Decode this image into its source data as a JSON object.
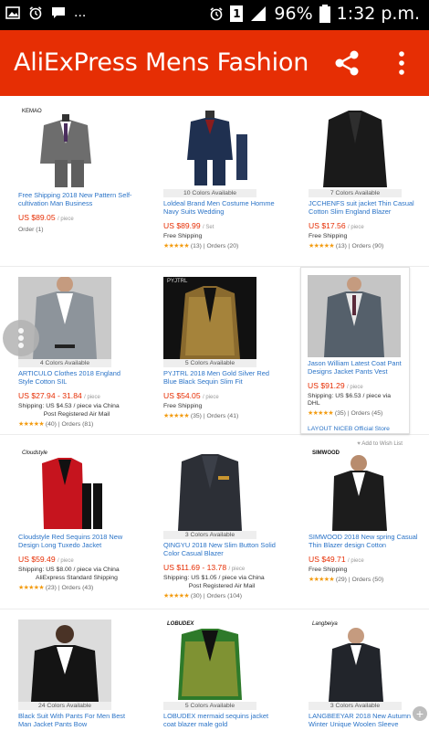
{
  "status_bar": {
    "battery_percent": "96%",
    "time": "1:32 p.m.",
    "sim_badge": "1"
  },
  "app_bar": {
    "title": "AliExPress Mens Fashion"
  },
  "products": [
    {
      "brand": "KEMAO",
      "colors": "",
      "title": "Free Shipping 2018 New Pattern Self-cultivation Man Business",
      "price": "US $89.05",
      "unit": "/ piece",
      "shipping": "",
      "shipping_detail": "",
      "stars": "",
      "rating": "",
      "orders": "Order (1)"
    },
    {
      "brand": "",
      "colors": "10 Colors Available",
      "title": "Loldeal Brand Men Costume Homme Navy Suits Wedding",
      "price": "US $89.99",
      "unit": "/ Set",
      "shipping": "Free Shipping",
      "shipping_detail": "",
      "stars": "★★★★★",
      "rating": "(13)",
      "orders": "Orders (20)"
    },
    {
      "brand": "",
      "colors": "7 Colors Available",
      "title": "JCCHENFS suit jacket Thin Casual Cotton Slim England Blazer",
      "price": "US $17.56",
      "unit": "/ piece",
      "shipping": "Free Shipping",
      "shipping_detail": "",
      "stars": "★★★★★",
      "rating": "(13)",
      "orders": "Orders (90)"
    },
    {
      "brand": "",
      "colors": "4 Colors Available",
      "title": "ARTICULO Clothes 2018 England Style Cotton SIL",
      "price": "US $27.94 - 31.84",
      "unit": "/ piece",
      "shipping": "Shipping: US $4.53 / piece via China",
      "shipping_detail": "Post Registered Air Mail",
      "stars": "★★★★★",
      "rating": "(40)",
      "orders": "Orders (81)"
    },
    {
      "brand": "PYJTRL",
      "colors": "5 Colors Available",
      "title": "PYJTRL 2018 Men Gold Silver Red Blue Black Sequin Slim Fit",
      "price": "US $54.05",
      "unit": "/ piece",
      "shipping": "Free Shipping",
      "shipping_detail": "",
      "stars": "★★★★★",
      "rating": "(35)",
      "orders": "Orders (41)"
    },
    {
      "brand": "",
      "colors": "",
      "title": "Jason William Latest Coat Pant Designs Jacket Pants Vest",
      "price": "US $91.29",
      "unit": "/ piece",
      "shipping": "Shipping: US $6.53 / piece via DHL",
      "shipping_detail": "",
      "stars": "★★★★★",
      "rating": "(35)",
      "orders": "Orders (45)",
      "store": "LAYOUT NICEB Official Store",
      "wish": "Add to Wish List"
    },
    {
      "brand": "Cloudstyle",
      "colors": "",
      "title": "Cloudstyle Red Sequins 2018 New Design Long Tuxedo Jacket",
      "price": "US $59.49",
      "unit": "/ piece",
      "shipping": "Shipping: US $8.00 / piece via China",
      "shipping_detail": "AliExpress Standard Shipping",
      "stars": "★★★★★",
      "rating": "(23)",
      "orders": "Orders (43)"
    },
    {
      "brand": "",
      "colors": "3 Colors Available",
      "title": "QINGYU 2018 New Slim Button Solid Color Casual Blazer",
      "price": "US $11.69 - 13.78",
      "unit": "/ piece",
      "shipping": "Shipping: US $1.05 / piece via China",
      "shipping_detail": "Post Registered Air Mail",
      "stars": "★★★★★",
      "rating": "(30)",
      "orders": "Orders (104)"
    },
    {
      "brand": "SIMWOOD",
      "colors": "",
      "title": "SIMWOOD 2018 New spring Casual Thin Blazer design Cotton",
      "price": "US $49.71",
      "unit": "/ piece",
      "shipping": "Free Shipping",
      "shipping_detail": "",
      "stars": "★★★★★",
      "rating": "(29)",
      "orders": "Orders (50)"
    },
    {
      "brand": "",
      "colors": "24 Colors Available",
      "title": "Black Suit With Pants For Men Best Man Jacket Pants Bow",
      "price": "",
      "unit": "",
      "shipping": "",
      "shipping_detail": "",
      "stars": "",
      "rating": "",
      "orders": ""
    },
    {
      "brand": "LOBUDEX",
      "colors": "5 Colors Available",
      "title": "LOBUDEX mermaid sequins jacket coat blazer male gold",
      "price": "",
      "unit": "",
      "shipping": "",
      "shipping_detail": "",
      "stars": "",
      "rating": "",
      "orders": ""
    },
    {
      "brand": "Langbeiya",
      "colors": "3 Colors Available",
      "title": "LANGBEEYAR 2018 New Autumn Winter Unique Woolen Sleeve",
      "price": "",
      "unit": "",
      "shipping": "",
      "shipping_detail": "",
      "stars": "",
      "rating": "",
      "orders": ""
    }
  ],
  "colors": {
    "accent": "#e62e04",
    "link": "#2a73c7",
    "star": "#f39c12"
  },
  "icons": [
    "image-icon",
    "alarm-icon",
    "message-icon",
    "share-icon",
    "more-vert-icon",
    "add-to-wishlist-icon",
    "side-handle-icon",
    "plus-icon"
  ]
}
